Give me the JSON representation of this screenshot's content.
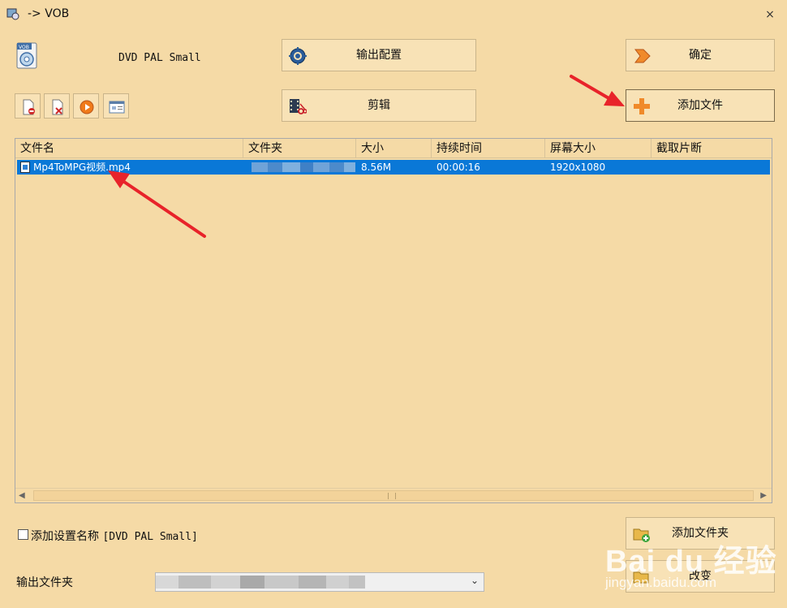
{
  "window": {
    "title": "-> VOB",
    "close_glyph": "×"
  },
  "profile": {
    "badge": "VOB",
    "name": "DVD PAL Small"
  },
  "buttons": {
    "output_config": "输出配置",
    "edit": "剪辑",
    "ok": "确定",
    "add_file": "添加文件",
    "add_folder": "添加文件夹",
    "change": "改变"
  },
  "toolbar": {
    "icons": [
      "remove-icon",
      "clear-icon",
      "play-icon",
      "info-icon"
    ]
  },
  "file_list": {
    "columns": [
      "文件名",
      "文件夹",
      "大小",
      "持续时间",
      "屏幕大小",
      "截取片断"
    ],
    "rows": [
      {
        "name": "Mp4ToMPG视频.mp4",
        "folder": "",
        "size": "8.56M",
        "duration": "00:00:16",
        "screen": "1920x1080",
        "clip": ""
      }
    ]
  },
  "options": {
    "add_setting_name_label": "添加设置名称",
    "add_setting_name_profile": "[DVD PAL Small]",
    "add_setting_name_checked": false
  },
  "output": {
    "folder_label": "输出文件夹",
    "folder_value": ""
  },
  "watermark": {
    "main": "Bai du 经验",
    "sub": "jingyan.baidu.com"
  },
  "colors": {
    "background": "#F5DAA6",
    "selection": "#0A78D7",
    "arrow": "#E8232A"
  }
}
